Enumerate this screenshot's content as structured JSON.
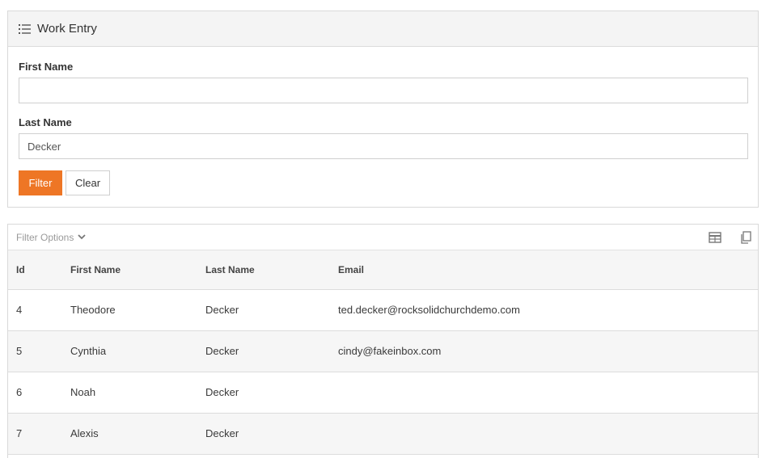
{
  "panel": {
    "title": "Work Entry",
    "icon": "list-icon"
  },
  "form": {
    "first_name": {
      "label": "First Name",
      "value": ""
    },
    "last_name": {
      "label": "Last Name",
      "value": "Decker"
    },
    "filter_label": "Filter",
    "clear_label": "Clear"
  },
  "grid": {
    "filter_options_label": "Filter Options",
    "tools": [
      "excel-export-icon",
      "copy-icon"
    ],
    "columns": [
      "Id",
      "First Name",
      "Last Name",
      "Email"
    ],
    "rows": [
      {
        "id": "4",
        "first_name": "Theodore",
        "last_name": "Decker",
        "email": "ted.decker@rocksolidchurchdemo.com"
      },
      {
        "id": "5",
        "first_name": "Cynthia",
        "last_name": "Decker",
        "email": "cindy@fakeinbox.com"
      },
      {
        "id": "6",
        "first_name": "Noah",
        "last_name": "Decker",
        "email": ""
      },
      {
        "id": "7",
        "first_name": "Alexis",
        "last_name": "Decker",
        "email": ""
      }
    ]
  },
  "colors": {
    "accent": "#ee7625",
    "heading_bg": "#f4f4f4",
    "border": "#d9d9d9"
  }
}
